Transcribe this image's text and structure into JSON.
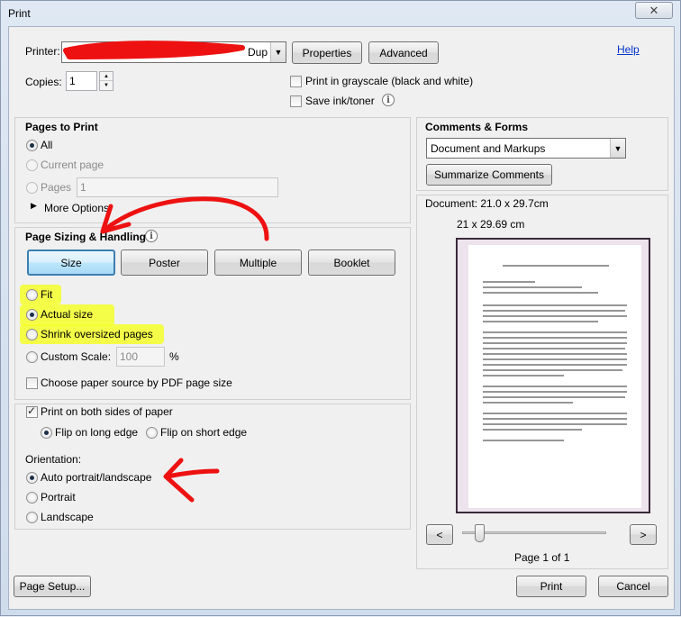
{
  "window": {
    "title": "Print",
    "close_glyph": "✕"
  },
  "printer": {
    "label": "Printer:",
    "selected_suffix": "Dup",
    "properties_label": "Properties",
    "advanced_label": "Advanced",
    "help_label": "Help",
    "copies_label": "Copies:",
    "copies_value": "1",
    "grayscale_label": "Print in grayscale (black and white)",
    "grayscale_checked": false,
    "save_ink_label": "Save ink/toner",
    "save_ink_checked": false
  },
  "pages_to_print": {
    "title": "Pages to Print",
    "all_label": "All",
    "current_page_label": "Current page",
    "pages_label": "Pages",
    "pages_value": "1",
    "more_options_label": "More Options",
    "selected": "All"
  },
  "page_sizing": {
    "title": "Page Sizing & Handling",
    "tabs": [
      "Size",
      "Poster",
      "Multiple",
      "Booklet"
    ],
    "active_tab": "Size",
    "fit_label": "Fit",
    "actual_size_label": "Actual size",
    "shrink_label": "Shrink oversized pages",
    "custom_scale_label": "Custom Scale:",
    "custom_scale_value": "100",
    "percent_label": "%",
    "paper_source_label": "Choose paper source by PDF page size",
    "selected": "Actual size"
  },
  "duplex": {
    "both_sides_label": "Print on both sides of paper",
    "both_sides_checked": true,
    "long_edge_label": "Flip on long edge",
    "short_edge_label": "Flip on short edge",
    "selected": "Flip on long edge"
  },
  "orientation": {
    "title": "Orientation:",
    "auto_label": "Auto portrait/landscape",
    "portrait_label": "Portrait",
    "landscape_label": "Landscape",
    "selected": "Auto portrait/landscape"
  },
  "comments_forms": {
    "title": "Comments & Forms",
    "selected": "Document and Markups",
    "summarize_label": "Summarize Comments"
  },
  "preview": {
    "document_size": "Document: 21.0 x 29.7cm",
    "page_size": "21 x 29.69 cm",
    "prev_glyph": "<",
    "next_glyph": ">",
    "page_indicator": "Page 1 of 1",
    "slider_position": 0
  },
  "footer": {
    "page_setup_label": "Page Setup...",
    "print_label": "Print",
    "cancel_label": "Cancel"
  },
  "annotation_colors": {
    "red": "#ee1111",
    "yellow": "#f4ff2a"
  },
  "icons": [
    "info-icon",
    "dropdown-arrow-icon",
    "spinner-up-icon",
    "spinner-down-icon",
    "expand-triangle-icon",
    "close-icon"
  ]
}
